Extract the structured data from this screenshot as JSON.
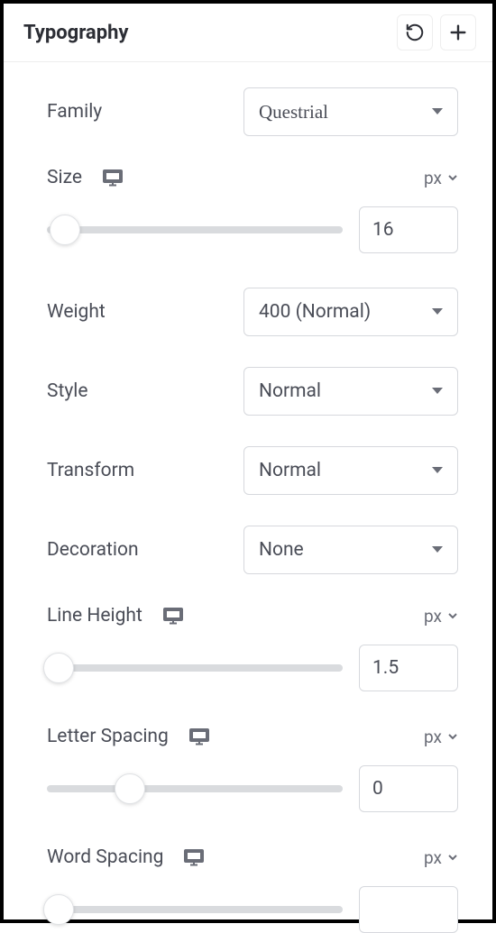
{
  "header": {
    "title": "Typography"
  },
  "family": {
    "label": "Family",
    "value": "Questrial"
  },
  "size": {
    "label": "Size",
    "unit": "px",
    "value": "16",
    "thumb_pct": 6
  },
  "weight": {
    "label": "Weight",
    "value": "400 (Normal)"
  },
  "style": {
    "label": "Style",
    "value": "Normal"
  },
  "transform": {
    "label": "Transform",
    "value": "Normal"
  },
  "decoration": {
    "label": "Decoration",
    "value": "None"
  },
  "line_height": {
    "label": "Line Height",
    "unit": "px",
    "value": "1.5",
    "thumb_pct": 4
  },
  "letter_spacing": {
    "label": "Letter Spacing",
    "unit": "px",
    "value": "0",
    "thumb_pct": 28
  },
  "word_spacing": {
    "label": "Word Spacing",
    "unit": "px",
    "value": "",
    "thumb_pct": 4
  }
}
